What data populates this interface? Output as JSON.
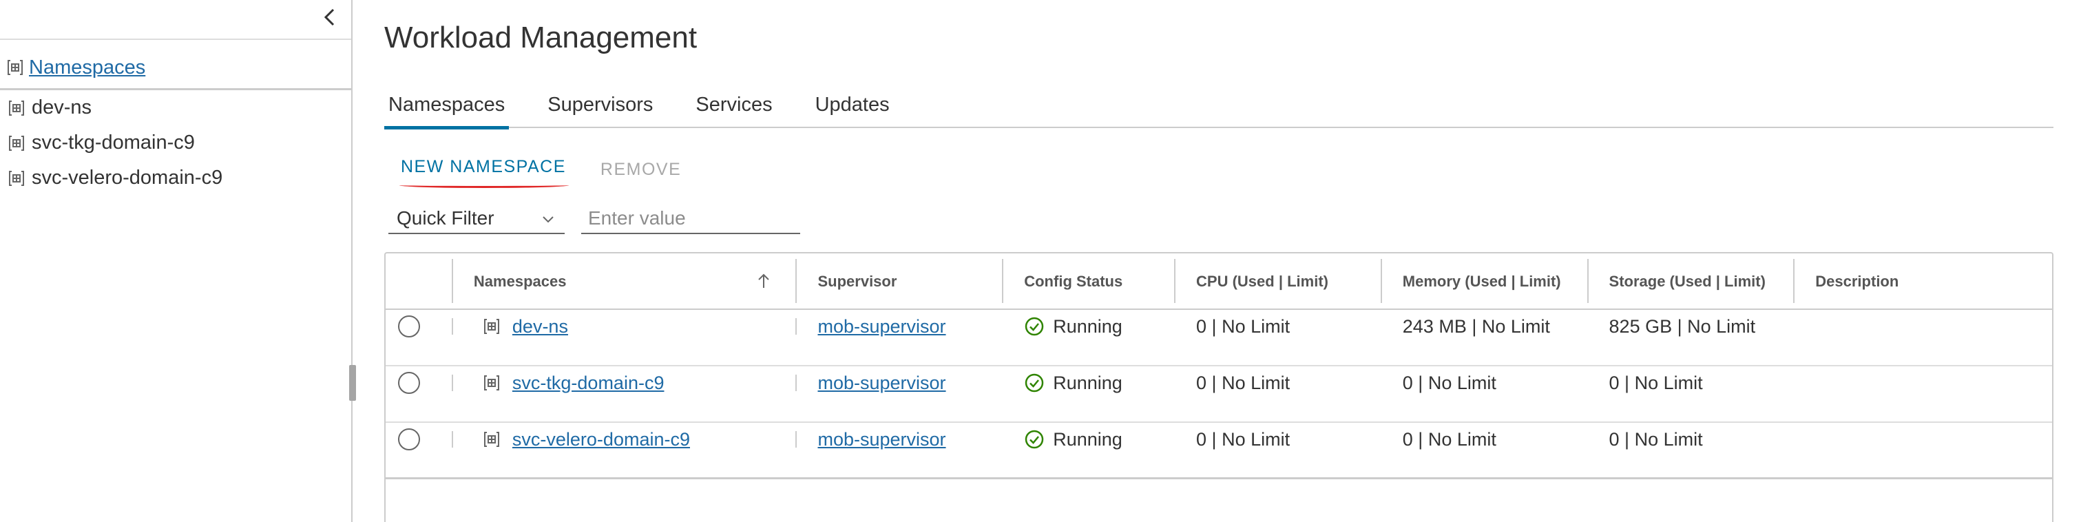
{
  "sidebar": {
    "header_label": "Namespaces",
    "items": [
      {
        "label": "dev-ns"
      },
      {
        "label": "svc-tkg-domain-c9"
      },
      {
        "label": "svc-velero-domain-c9"
      }
    ]
  },
  "page": {
    "title": "Workload Management"
  },
  "tabs": [
    {
      "label": "Namespaces",
      "active": true
    },
    {
      "label": "Supervisors",
      "active": false
    },
    {
      "label": "Services",
      "active": false
    },
    {
      "label": "Updates",
      "active": false
    }
  ],
  "toolbar": {
    "new_label": "NEW NAMESPACE",
    "remove_label": "REMOVE"
  },
  "filter": {
    "quick_filter_label": "Quick Filter",
    "value_placeholder": "Enter value"
  },
  "grid": {
    "columns": {
      "namespaces": "Namespaces",
      "supervisor": "Supervisor",
      "config_status": "Config Status",
      "cpu": "CPU (Used | Limit)",
      "memory": "Memory (Used | Limit)",
      "storage": "Storage (Used | Limit)",
      "description": "Description"
    },
    "rows": [
      {
        "name": "dev-ns",
        "supervisor": "mob-supervisor",
        "status": "Running",
        "cpu": "0 | No Limit",
        "memory": "243 MB | No Limit",
        "storage": "825 GB | No Limit",
        "description": ""
      },
      {
        "name": "svc-tkg-domain-c9",
        "supervisor": "mob-supervisor",
        "status": "Running",
        "cpu": "0 | No Limit",
        "memory": "0 | No Limit",
        "storage": "0 | No Limit",
        "description": ""
      },
      {
        "name": "svc-velero-domain-c9",
        "supervisor": "mob-supervisor",
        "status": "Running",
        "cpu": "0 | No Limit",
        "memory": "0 | No Limit",
        "storage": "0 | No Limit",
        "description": ""
      }
    ]
  },
  "icons": {
    "namespace": "namespace-icon",
    "collapse": "chevron-left-icon",
    "sort": "arrow-up-icon",
    "dropdown": "chevron-down-icon",
    "status_ok": "check-circle-icon"
  },
  "colors": {
    "link": "#1f6aa5",
    "accent": "#0072a3",
    "status_ok": "#2f8400",
    "disabled": "#a8a8a8"
  }
}
